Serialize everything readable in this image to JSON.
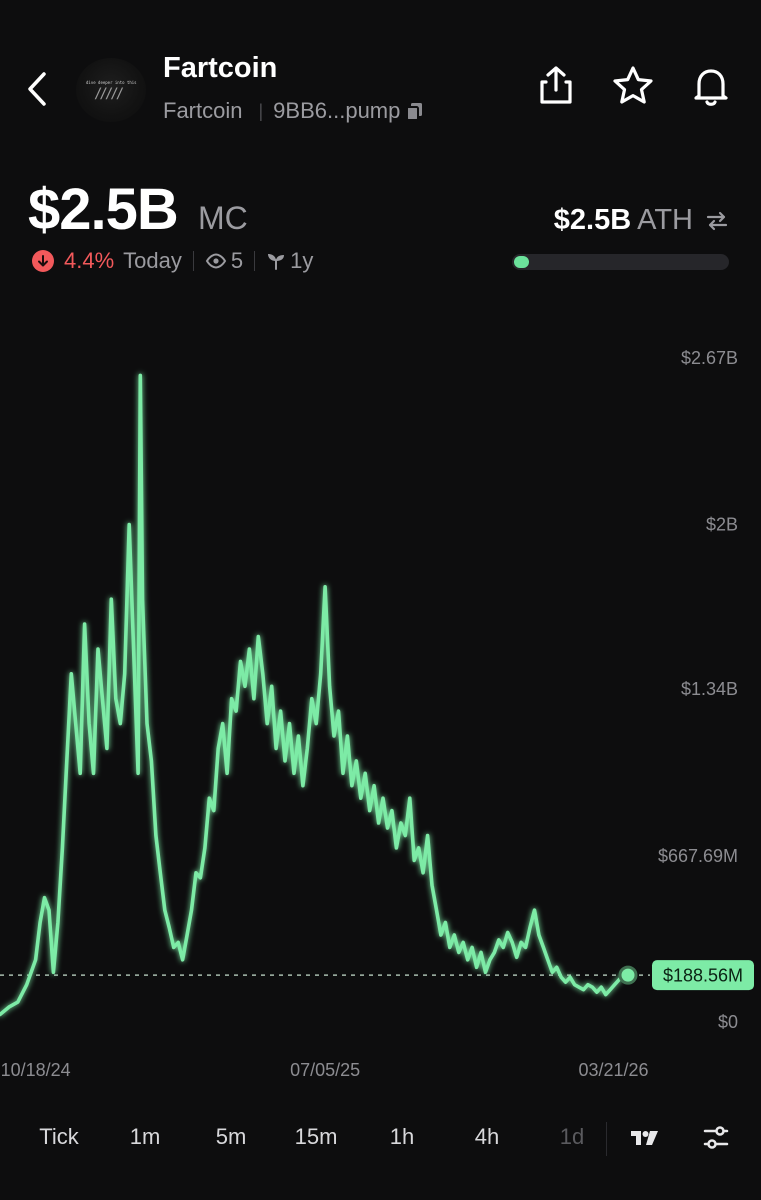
{
  "header": {
    "back_icon": "chevron-left-icon",
    "token_name": "Fartcoin",
    "token_symbol": "Fartcoin",
    "contract_short": "9BB6...pump",
    "logo_text": "dive deeper into this",
    "copy_icon": "copy-icon",
    "actions": [
      "share-icon",
      "star-icon",
      "bell-icon"
    ]
  },
  "market_cap": {
    "value": "$2.5B",
    "unit": "MC",
    "change_direction_icon": "arrow-down-icon",
    "change_pct": "4.4%",
    "change_label": "Today",
    "views_icon": "eye-icon",
    "views": "5",
    "age_icon": "sprout-icon",
    "age": "1y"
  },
  "ath": {
    "value": "$2.5B",
    "label": "ATH",
    "swap_icon": "swap-icon",
    "progress": 0.07,
    "progress_color": "#6be29b"
  },
  "chart_data": {
    "type": "line",
    "color": "#7deba6",
    "y_ticks": [
      "$2.67B",
      "$2B",
      "$1.34B",
      "$667.69M",
      "$0"
    ],
    "y_tick_values": [
      2670000000,
      2000000000,
      1340000000,
      667690000,
      0
    ],
    "x_ticks": [
      "10/18/24",
      "07/05/25",
      "03/21/26"
    ],
    "x_tick_values": [
      "2024-10-18",
      "2025-07-05",
      "2026-03-21"
    ],
    "current_value_label": "$188.56M",
    "current_value": 188560000,
    "ylim": [
      0,
      2670000000
    ],
    "grid": false,
    "x": [
      "2024-09-16",
      "2024-09-24",
      "2024-10-02",
      "2024-10-10",
      "2024-10-18",
      "2024-10-22",
      "2024-10-26",
      "2024-10-30",
      "2024-11-03",
      "2024-11-07",
      "2024-11-11",
      "2024-11-15",
      "2024-11-19",
      "2024-11-23",
      "2024-11-27",
      "2024-12-01",
      "2024-12-05",
      "2024-12-09",
      "2024-12-13",
      "2024-12-17",
      "2024-12-21",
      "2024-12-25",
      "2024-12-29",
      "2025-01-02",
      "2025-01-06",
      "2025-01-10",
      "2025-01-14",
      "2025-01-18",
      "2025-01-20",
      "2025-01-22",
      "2025-01-26",
      "2025-01-30",
      "2025-02-03",
      "2025-02-07",
      "2025-02-11",
      "2025-02-15",
      "2025-02-19",
      "2025-02-23",
      "2025-02-27",
      "2025-03-03",
      "2025-03-07",
      "2025-03-11",
      "2025-03-15",
      "2025-03-19",
      "2025-03-23",
      "2025-03-27",
      "2025-03-31",
      "2025-04-04",
      "2025-04-08",
      "2025-04-12",
      "2025-04-16",
      "2025-04-20",
      "2025-04-24",
      "2025-04-28",
      "2025-05-02",
      "2025-05-06",
      "2025-05-10",
      "2025-05-14",
      "2025-05-18",
      "2025-05-22",
      "2025-05-26",
      "2025-05-30",
      "2025-06-03",
      "2025-06-07",
      "2025-06-11",
      "2025-06-15",
      "2025-06-19",
      "2025-06-23",
      "2025-06-27",
      "2025-07-01",
      "2025-07-05",
      "2025-07-09",
      "2025-07-13",
      "2025-07-17",
      "2025-07-21",
      "2025-07-25",
      "2025-07-29",
      "2025-08-02",
      "2025-08-06",
      "2025-08-10",
      "2025-08-14",
      "2025-08-18",
      "2025-08-22",
      "2025-08-26",
      "2025-08-30",
      "2025-09-03",
      "2025-09-07",
      "2025-09-11",
      "2025-09-15",
      "2025-09-19",
      "2025-09-23",
      "2025-09-27",
      "2025-10-01",
      "2025-10-05",
      "2025-10-09",
      "2025-10-13",
      "2025-10-17",
      "2025-10-21",
      "2025-10-25",
      "2025-10-29",
      "2025-11-02",
      "2025-11-06",
      "2025-11-10",
      "2025-11-14",
      "2025-11-18",
      "2025-11-22",
      "2025-11-26",
      "2025-11-30",
      "2025-12-04",
      "2025-12-08",
      "2025-12-12",
      "2025-12-16",
      "2025-12-20",
      "2025-12-24",
      "2025-12-28",
      "2026-01-01",
      "2026-01-05",
      "2026-01-09",
      "2026-01-13",
      "2026-01-17",
      "2026-01-21",
      "2026-01-25",
      "2026-01-29",
      "2026-02-02",
      "2026-02-06",
      "2026-02-10",
      "2026-02-14",
      "2026-02-18",
      "2026-02-22",
      "2026-02-26",
      "2026-03-02",
      "2026-03-06",
      "2026-03-10",
      "2026-03-14",
      "2026-03-18",
      "2026-03-22",
      "2026-03-26",
      "2026-03-30",
      "2026-04-03"
    ],
    "values": [
      30000000,
      60000000,
      80000000,
      150000000,
      250000000,
      400000000,
      500000000,
      450000000,
      200000000,
      400000000,
      700000000,
      1050000000,
      1400000000,
      1200000000,
      1000000000,
      1600000000,
      1200000000,
      1000000000,
      1500000000,
      1300000000,
      1100000000,
      1700000000,
      1300000000,
      1200000000,
      1400000000,
      2000000000,
      1500000000,
      1000000000,
      2600000000,
      1700000000,
      1200000000,
      1050000000,
      750000000,
      600000000,
      450000000,
      380000000,
      300000000,
      320000000,
      250000000,
      350000000,
      450000000,
      600000000,
      580000000,
      700000000,
      900000000,
      850000000,
      1100000000,
      1200000000,
      1000000000,
      1300000000,
      1250000000,
      1450000000,
      1350000000,
      1500000000,
      1300000000,
      1550000000,
      1400000000,
      1200000000,
      1350000000,
      1100000000,
      1250000000,
      1050000000,
      1200000000,
      1000000000,
      1150000000,
      950000000,
      1100000000,
      1300000000,
      1200000000,
      1400000000,
      1750000000,
      1350000000,
      1150000000,
      1250000000,
      1000000000,
      1150000000,
      950000000,
      1050000000,
      900000000,
      1000000000,
      850000000,
      950000000,
      800000000,
      900000000,
      780000000,
      850000000,
      700000000,
      800000000,
      750000000,
      900000000,
      650000000,
      700000000,
      600000000,
      750000000,
      550000000,
      450000000,
      350000000,
      400000000,
      300000000,
      350000000,
      280000000,
      320000000,
      250000000,
      300000000,
      220000000,
      280000000,
      200000000,
      250000000,
      280000000,
      330000000,
      300000000,
      360000000,
      320000000,
      260000000,
      320000000,
      300000000,
      380000000,
      450000000,
      350000000,
      300000000,
      250000000,
      200000000,
      220000000,
      180000000,
      160000000,
      180000000,
      150000000,
      140000000,
      130000000,
      150000000,
      140000000,
      120000000,
      140000000,
      110000000,
      130000000,
      150000000,
      170000000,
      188560000,
      188560000
    ]
  },
  "intervals": {
    "items": [
      "Tick",
      "1m",
      "5m",
      "15m",
      "1h",
      "4h",
      "1d"
    ],
    "active": "1d",
    "chart_type_icon": "tradingview-icon",
    "settings_icon": "sliders-icon"
  }
}
